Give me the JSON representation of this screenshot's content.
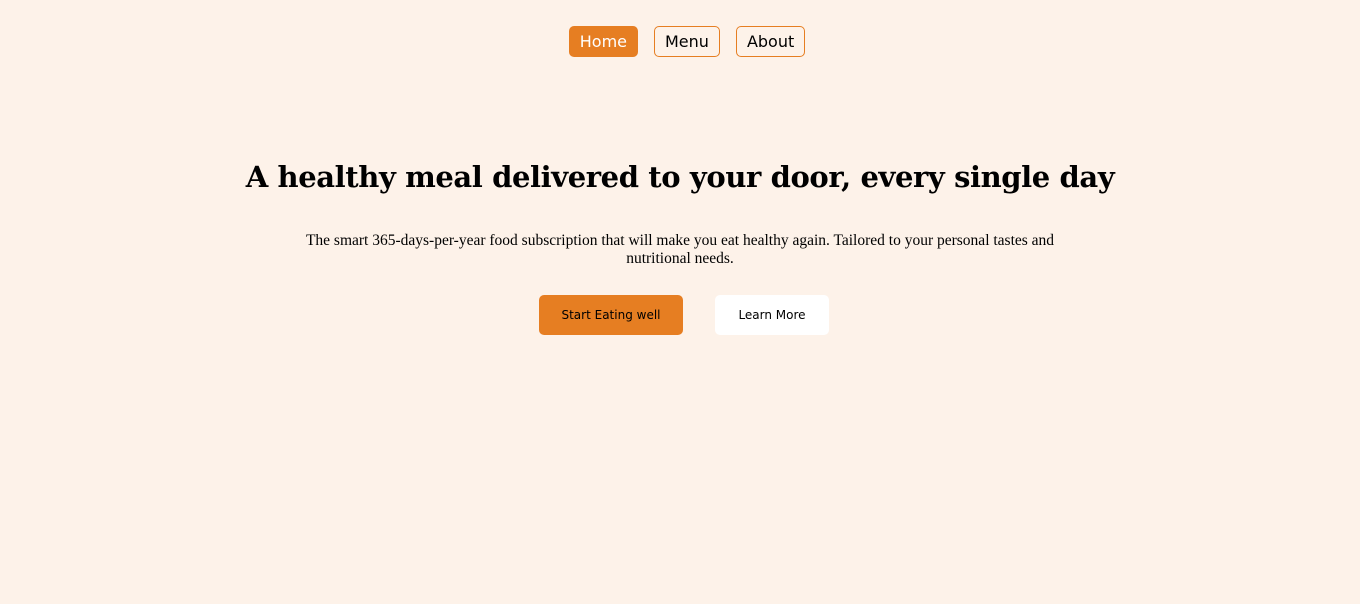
{
  "nav": {
    "items": [
      {
        "label": "Home",
        "active": true
      },
      {
        "label": "Menu",
        "active": false
      },
      {
        "label": "About",
        "active": false
      }
    ]
  },
  "hero": {
    "title": "A healthy meal delivered to your door, every single day",
    "subtitle": "The smart 365-days-per-year food subscription that will make you eat healthy again. Tailored to your personal tastes and nutritional needs.",
    "primary_cta": "Start Eating well",
    "secondary_cta": "Learn More"
  },
  "colors": {
    "background": "#fdf2e9",
    "accent": "#e67e22",
    "secondary_button": "#ffffff"
  }
}
